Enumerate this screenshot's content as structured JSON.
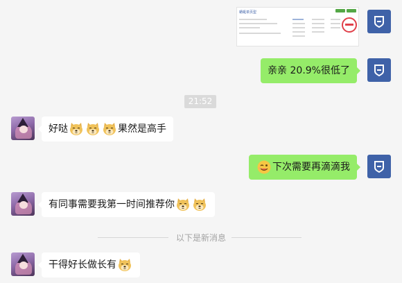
{
  "messages": {
    "m2_text": "亲亲 20.9%很低了",
    "time_label": "21:52",
    "m3_text_before": "好哒",
    "m3_text_after": "果然是高手",
    "m4_text": "下次需要再滴滴我",
    "m5_text": "有同事需要我第一时间推荐你",
    "divider_label": "以下是新消息",
    "m6_text": "干得好长做长有"
  },
  "thumbnail": {
    "title": "蜻蜓单页型"
  },
  "icons": {
    "my_avatar": "shield-icon",
    "other_avatar": "anime-girl-avatar",
    "doge": "doge-emoji",
    "wink": "wink-emoji"
  },
  "colors": {
    "my_bubble": "#95ec69",
    "other_bubble": "#ffffff",
    "my_avatar_bg": "#3f62a8"
  }
}
